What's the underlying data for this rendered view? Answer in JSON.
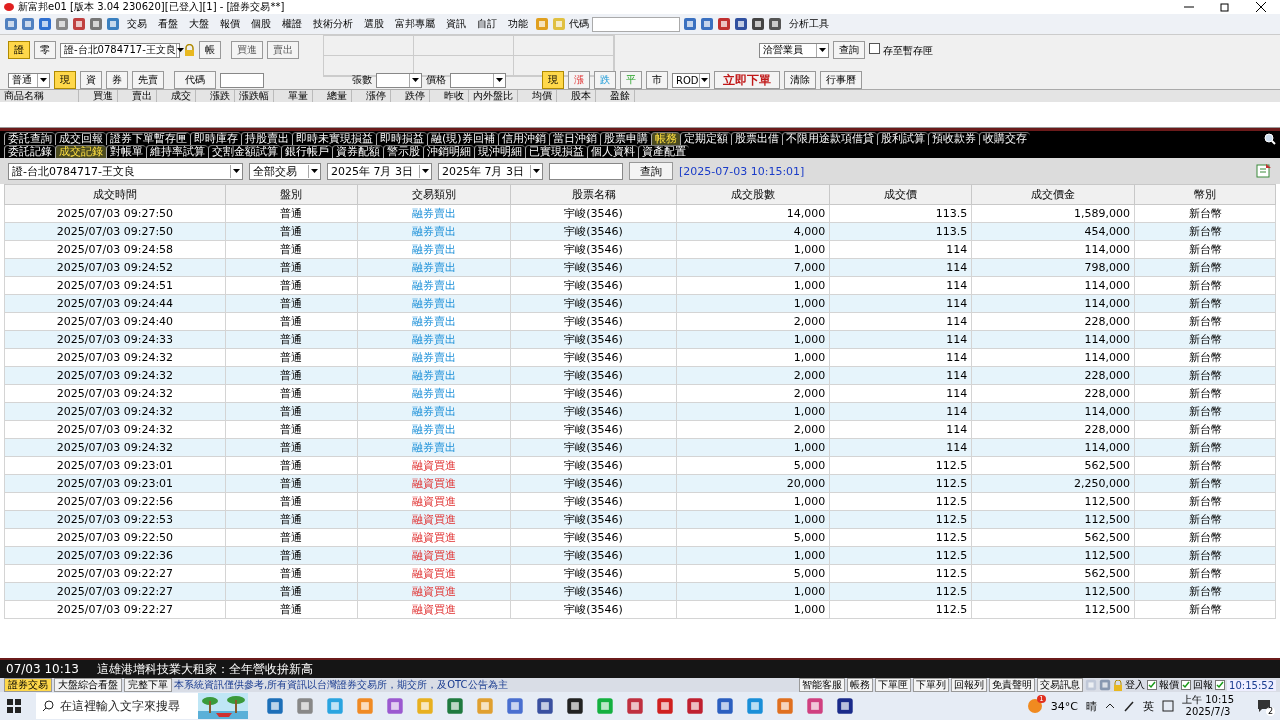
{
  "title_bar": {
    "title": "新富邦e01 [版本 3.04 230620][已登入][1] - [證券交易**]"
  },
  "menu": {
    "items": [
      "交易",
      "看盤",
      "大盤",
      "報價",
      "個股",
      "權證",
      "技術分析",
      "選股",
      "富邦專屬",
      "資訊",
      "自訂",
      "功能"
    ],
    "code_label": "代碼",
    "tools": "分析工具"
  },
  "order_panel": {
    "markets": [
      {
        "label": "證",
        "selected": true
      },
      {
        "label": "零",
        "selected": false
      }
    ],
    "account": "證-台北0784717-王文良",
    "account_button": "帳",
    "buy": "買進",
    "sell": "賣出",
    "agent": "洽營業員",
    "query": "查詢",
    "save_box": {
      "label": "存至暫存匣",
      "checked": false
    },
    "session": "普通",
    "credit": [
      {
        "label": "現",
        "selected": true
      },
      {
        "label": "資",
        "selected": false
      },
      {
        "label": "券",
        "selected": false
      },
      {
        "label": "先賣",
        "selected": false
      }
    ],
    "code_button": "代碼",
    "lots_label": "張數",
    "price_label": "價格",
    "price_types": [
      {
        "label": "現",
        "selected": true,
        "kind": "current"
      },
      {
        "label": "漲",
        "selected": false,
        "kind": "up"
      },
      {
        "label": "跌",
        "selected": false,
        "kind": "down"
      },
      {
        "label": "平",
        "selected": false,
        "kind": "flat"
      },
      {
        "label": "市",
        "selected": false,
        "kind": "market"
      }
    ],
    "tif": "ROD",
    "submit": "立即下單",
    "clear": "清除",
    "calendar": "行事曆"
  },
  "quote_columns": [
    "商品名稱",
    "買進",
    "賣出",
    "成交",
    "漲跌",
    "漲跌幅",
    "單量",
    "總量",
    "漲停",
    "跌停",
    "昨收",
    "內外盤比",
    "均價",
    "股本",
    "盈餘"
  ],
  "tabs_row1": [
    {
      "label": "委託查詢",
      "selected": false
    },
    {
      "label": "成交回報",
      "selected": false
    },
    {
      "label": "證券下單暫存匣",
      "selected": false
    },
    {
      "label": "即時庫存",
      "selected": false
    },
    {
      "label": "持股賣出",
      "selected": false
    },
    {
      "label": "即時未實現損益",
      "selected": false
    },
    {
      "label": "即時損益",
      "selected": false
    },
    {
      "label": "融(現)券回補",
      "selected": false
    },
    {
      "label": "信用沖銷",
      "selected": false
    },
    {
      "label": "當日沖銷",
      "selected": false
    },
    {
      "label": "股票申購",
      "selected": false
    },
    {
      "label": "帳務",
      "selected": true
    },
    {
      "label": "定期定額",
      "selected": false
    },
    {
      "label": "股票出借",
      "selected": false
    },
    {
      "label": "不限用途款項借貸",
      "selected": false
    },
    {
      "label": "股利試算",
      "selected": false
    },
    {
      "label": "預收款券",
      "selected": false
    },
    {
      "label": "收購交存",
      "selected": false
    }
  ],
  "tabs_row2": [
    {
      "label": "委託記錄",
      "selected": false
    },
    {
      "label": "成交記錄",
      "selected": true
    },
    {
      "label": "對帳單",
      "selected": false
    },
    {
      "label": "維持率試算",
      "selected": false
    },
    {
      "label": "交割金額試算",
      "selected": false
    },
    {
      "label": "銀行帳戶",
      "selected": false
    },
    {
      "label": "資券配額",
      "selected": false
    },
    {
      "label": "警示股",
      "selected": false
    },
    {
      "label": "沖銷明細",
      "selected": false
    },
    {
      "label": "現沖明細",
      "selected": false
    },
    {
      "label": "已實現損益",
      "selected": false
    },
    {
      "label": "個人資料",
      "selected": false
    },
    {
      "label": "資產配置",
      "selected": false
    }
  ],
  "filter": {
    "account": "證-台北0784717-王文良",
    "trade_type": "全部交易",
    "date_from": "2025年 7月 3日",
    "date_to": "2025年 7月 3日",
    "query": "查詢",
    "timestamp": "[2025-07-03 10:15:01]"
  },
  "table": {
    "columns": [
      "成交時間",
      "盤別",
      "交易類別",
      "股票名稱",
      "成交股數",
      "成交價",
      "成交價金",
      "幣別"
    ],
    "rows": [
      {
        "kind": "sell",
        "cells": [
          "2025/07/03 09:27:50",
          "普通",
          "融券賣出",
          "宇峻(3546)",
          "14,000",
          "113.5",
          "1,589,000",
          "新台幣"
        ]
      },
      {
        "kind": "sell",
        "cells": [
          "2025/07/03 09:27:50",
          "普通",
          "融券賣出",
          "宇峻(3546)",
          "4,000",
          "113.5",
          "454,000",
          "新台幣"
        ]
      },
      {
        "kind": "sell",
        "cells": [
          "2025/07/03 09:24:58",
          "普通",
          "融券賣出",
          "宇峻(3546)",
          "1,000",
          "114",
          "114,000",
          "新台幣"
        ]
      },
      {
        "kind": "sell",
        "cells": [
          "2025/07/03 09:24:52",
          "普通",
          "融券賣出",
          "宇峻(3546)",
          "7,000",
          "114",
          "798,000",
          "新台幣"
        ]
      },
      {
        "kind": "sell",
        "cells": [
          "2025/07/03 09:24:51",
          "普通",
          "融券賣出",
          "宇峻(3546)",
          "1,000",
          "114",
          "114,000",
          "新台幣"
        ]
      },
      {
        "kind": "sell",
        "cells": [
          "2025/07/03 09:24:44",
          "普通",
          "融券賣出",
          "宇峻(3546)",
          "1,000",
          "114",
          "114,000",
          "新台幣"
        ]
      },
      {
        "kind": "sell",
        "cells": [
          "2025/07/03 09:24:40",
          "普通",
          "融券賣出",
          "宇峻(3546)",
          "2,000",
          "114",
          "228,000",
          "新台幣"
        ]
      },
      {
        "kind": "sell",
        "cells": [
          "2025/07/03 09:24:33",
          "普通",
          "融券賣出",
          "宇峻(3546)",
          "1,000",
          "114",
          "114,000",
          "新台幣"
        ]
      },
      {
        "kind": "sell",
        "cells": [
          "2025/07/03 09:24:32",
          "普通",
          "融券賣出",
          "宇峻(3546)",
          "1,000",
          "114",
          "114,000",
          "新台幣"
        ]
      },
      {
        "kind": "sell",
        "cells": [
          "2025/07/03 09:24:32",
          "普通",
          "融券賣出",
          "宇峻(3546)",
          "2,000",
          "114",
          "228,000",
          "新台幣"
        ]
      },
      {
        "kind": "sell",
        "cells": [
          "2025/07/03 09:24:32",
          "普通",
          "融券賣出",
          "宇峻(3546)",
          "2,000",
          "114",
          "228,000",
          "新台幣"
        ]
      },
      {
        "kind": "sell",
        "cells": [
          "2025/07/03 09:24:32",
          "普通",
          "融券賣出",
          "宇峻(3546)",
          "1,000",
          "114",
          "114,000",
          "新台幣"
        ]
      },
      {
        "kind": "sell",
        "cells": [
          "2025/07/03 09:24:32",
          "普通",
          "融券賣出",
          "宇峻(3546)",
          "2,000",
          "114",
          "228,000",
          "新台幣"
        ]
      },
      {
        "kind": "sell",
        "cells": [
          "2025/07/03 09:24:32",
          "普通",
          "融券賣出",
          "宇峻(3546)",
          "1,000",
          "114",
          "114,000",
          "新台幣"
        ]
      },
      {
        "kind": "buy",
        "cells": [
          "2025/07/03 09:23:01",
          "普通",
          "融資買進",
          "宇峻(3546)",
          "5,000",
          "112.5",
          "562,500",
          "新台幣"
        ]
      },
      {
        "kind": "buy",
        "cells": [
          "2025/07/03 09:23:01",
          "普通",
          "融資買進",
          "宇峻(3546)",
          "20,000",
          "112.5",
          "2,250,000",
          "新台幣"
        ]
      },
      {
        "kind": "buy",
        "cells": [
          "2025/07/03 09:22:56",
          "普通",
          "融資買進",
          "宇峻(3546)",
          "1,000",
          "112.5",
          "112,500",
          "新台幣"
        ]
      },
      {
        "kind": "buy",
        "cells": [
          "2025/07/03 09:22:53",
          "普通",
          "融資買進",
          "宇峻(3546)",
          "1,000",
          "112.5",
          "112,500",
          "新台幣"
        ]
      },
      {
        "kind": "buy",
        "cells": [
          "2025/07/03 09:22:50",
          "普通",
          "融資買進",
          "宇峻(3546)",
          "5,000",
          "112.5",
          "562,500",
          "新台幣"
        ]
      },
      {
        "kind": "buy",
        "cells": [
          "2025/07/03 09:22:36",
          "普通",
          "融資買進",
          "宇峻(3546)",
          "1,000",
          "112.5",
          "112,500",
          "新台幣"
        ]
      },
      {
        "kind": "buy",
        "cells": [
          "2025/07/03 09:22:27",
          "普通",
          "融資買進",
          "宇峻(3546)",
          "5,000",
          "112.5",
          "562,500",
          "新台幣"
        ]
      },
      {
        "kind": "buy",
        "cells": [
          "2025/07/03 09:22:27",
          "普通",
          "融資買進",
          "宇峻(3546)",
          "1,000",
          "112.5",
          "112,500",
          "新台幣"
        ]
      },
      {
        "kind": "buy",
        "cells": [
          "2025/07/03 09:22:27",
          "普通",
          "融資買進",
          "宇峻(3546)",
          "1,000",
          "112.5",
          "112,500",
          "新台幣"
        ]
      }
    ]
  },
  "ticker": {
    "time": "07/03 10:13",
    "headline": "這雄港增科技業大租家：全年營收拚新高"
  },
  "status_bar": {
    "tabs": [
      {
        "label": "證券交易",
        "selected": true
      },
      {
        "label": "大盤綜合看盤",
        "selected": false
      },
      {
        "label": "完整下單",
        "selected": false
      }
    ],
    "notice": "本系統資訊僅供參考,所有資訊以台灣證券交易所，期交所，及OTC公告為主",
    "buttons": [
      "智能客服",
      "帳務",
      "下單匣",
      "下單列",
      "回報列",
      "免責聲明",
      "交易訊息"
    ],
    "indicators": [
      {
        "label": "登入",
        "checked": true
      },
      {
        "label": "報價",
        "checked": true
      },
      {
        "label": "回報",
        "checked": true
      }
    ],
    "time": "10:15:52"
  },
  "taskbar": {
    "search_placeholder": "在這裡輸入文字來搜尋",
    "weather_badge": "1",
    "temperature": "34°C",
    "weather": "晴",
    "ime": "英",
    "time": "上午 10:15",
    "date": "2025/7/3",
    "notifications": "2"
  }
}
